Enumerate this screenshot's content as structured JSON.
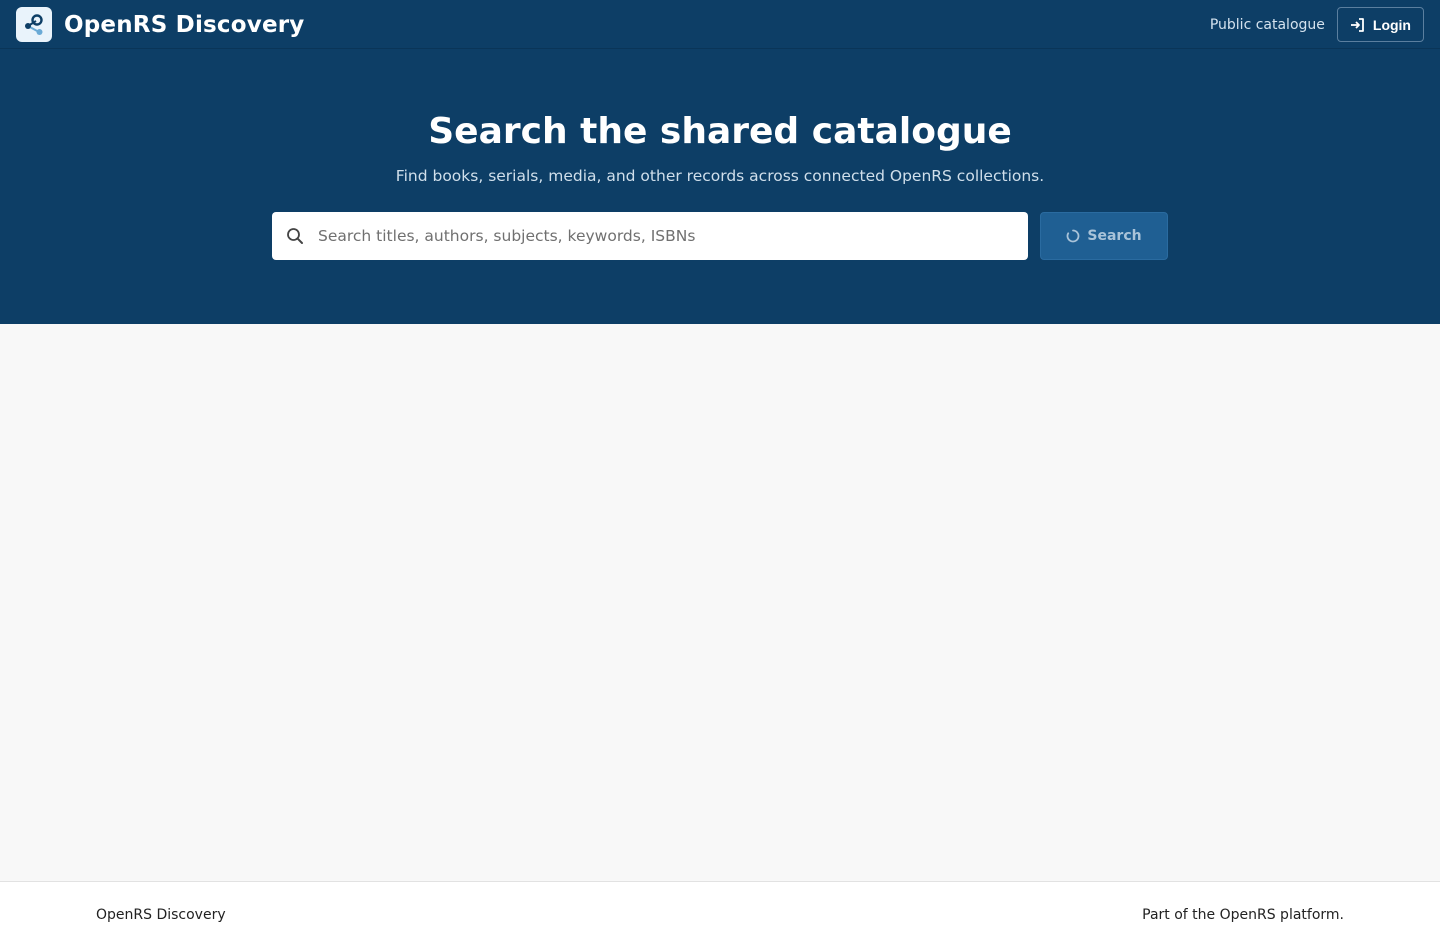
{
  "header": {
    "brand_name": "OpenRS Discovery",
    "nav_link": "Public catalogue",
    "login_label": "Login"
  },
  "hero": {
    "title": "Search the shared catalogue",
    "subtitle": "Find books, serials, media, and other records across connected OpenRS collections.",
    "search_placeholder": "Search titles, authors, subjects, keywords, ISBNs",
    "search_value": "",
    "search_button_label": "Search"
  },
  "footer": {
    "left_text": "OpenRS Discovery",
    "right_text": "Part of the OpenRS platform."
  },
  "colors": {
    "header_bg": "#0d3e66",
    "search_button_bg": "#1f5f93",
    "page_bg": "#f8f8f8"
  },
  "icons": {
    "brand": "share-nodes-icon",
    "login": "sign-in-icon",
    "search": "search-icon",
    "loading": "spinner-icon"
  }
}
